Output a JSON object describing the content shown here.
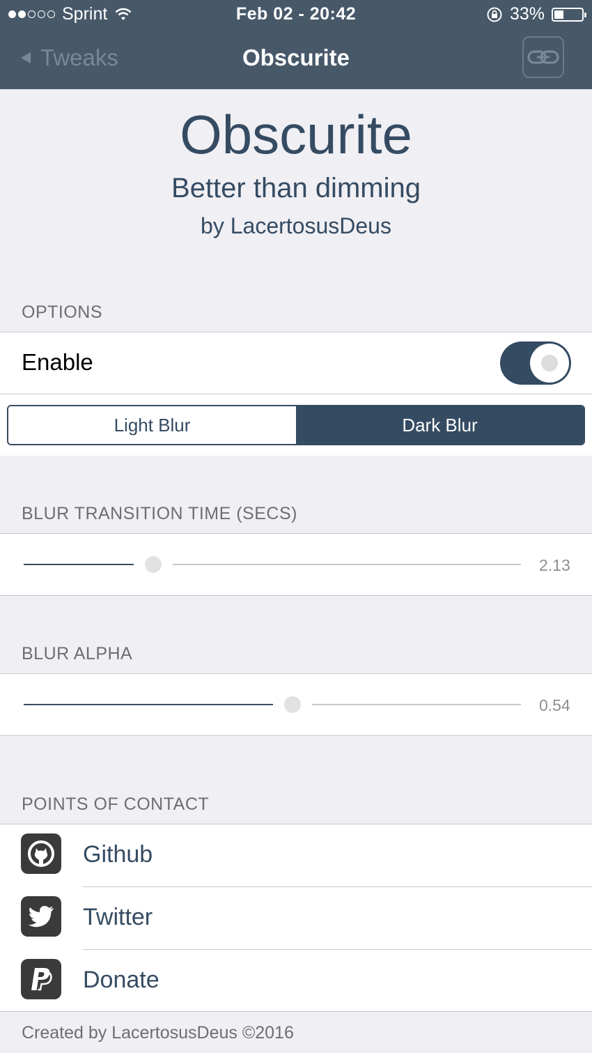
{
  "status_bar": {
    "carrier": "Sprint",
    "signal_bars_filled": 2,
    "signal_bars_total": 5,
    "datetime": "Feb 02 - 20:42",
    "battery_percent_label": "33%",
    "battery_level": 0.33
  },
  "nav": {
    "back_label": "Tweaks",
    "title": "Obscurite",
    "link_button_icon": "link-icon"
  },
  "header": {
    "name": "Obscurite",
    "tagline": "Better than dimming",
    "author": "by LacertosusDeus"
  },
  "options": {
    "section_label": "OPTIONS",
    "enable_label": "Enable",
    "enable_on": true,
    "segments": [
      {
        "label": "Light Blur",
        "selected": false
      },
      {
        "label": "Dark Blur",
        "selected": true
      }
    ]
  },
  "transition": {
    "section_label": "BLUR TRANSITION TIME (SECS)",
    "value_label": "2.13",
    "fraction": 0.26
  },
  "alpha": {
    "section_label": "BLUR ALPHA",
    "value_label": "0.54",
    "fraction": 0.54
  },
  "contact": {
    "section_label": "POINTS OF CONTACT",
    "items": [
      {
        "label": "Github",
        "icon": "github-icon"
      },
      {
        "label": "Twitter",
        "icon": "twitter-icon"
      },
      {
        "label": "Donate",
        "icon": "paypal-icon"
      }
    ]
  },
  "footer": {
    "text": "Created by LacertosusDeus ©2016"
  },
  "colors": {
    "accent": "#354b62",
    "nav_background": "#475869",
    "page_background": "#efeff4"
  }
}
